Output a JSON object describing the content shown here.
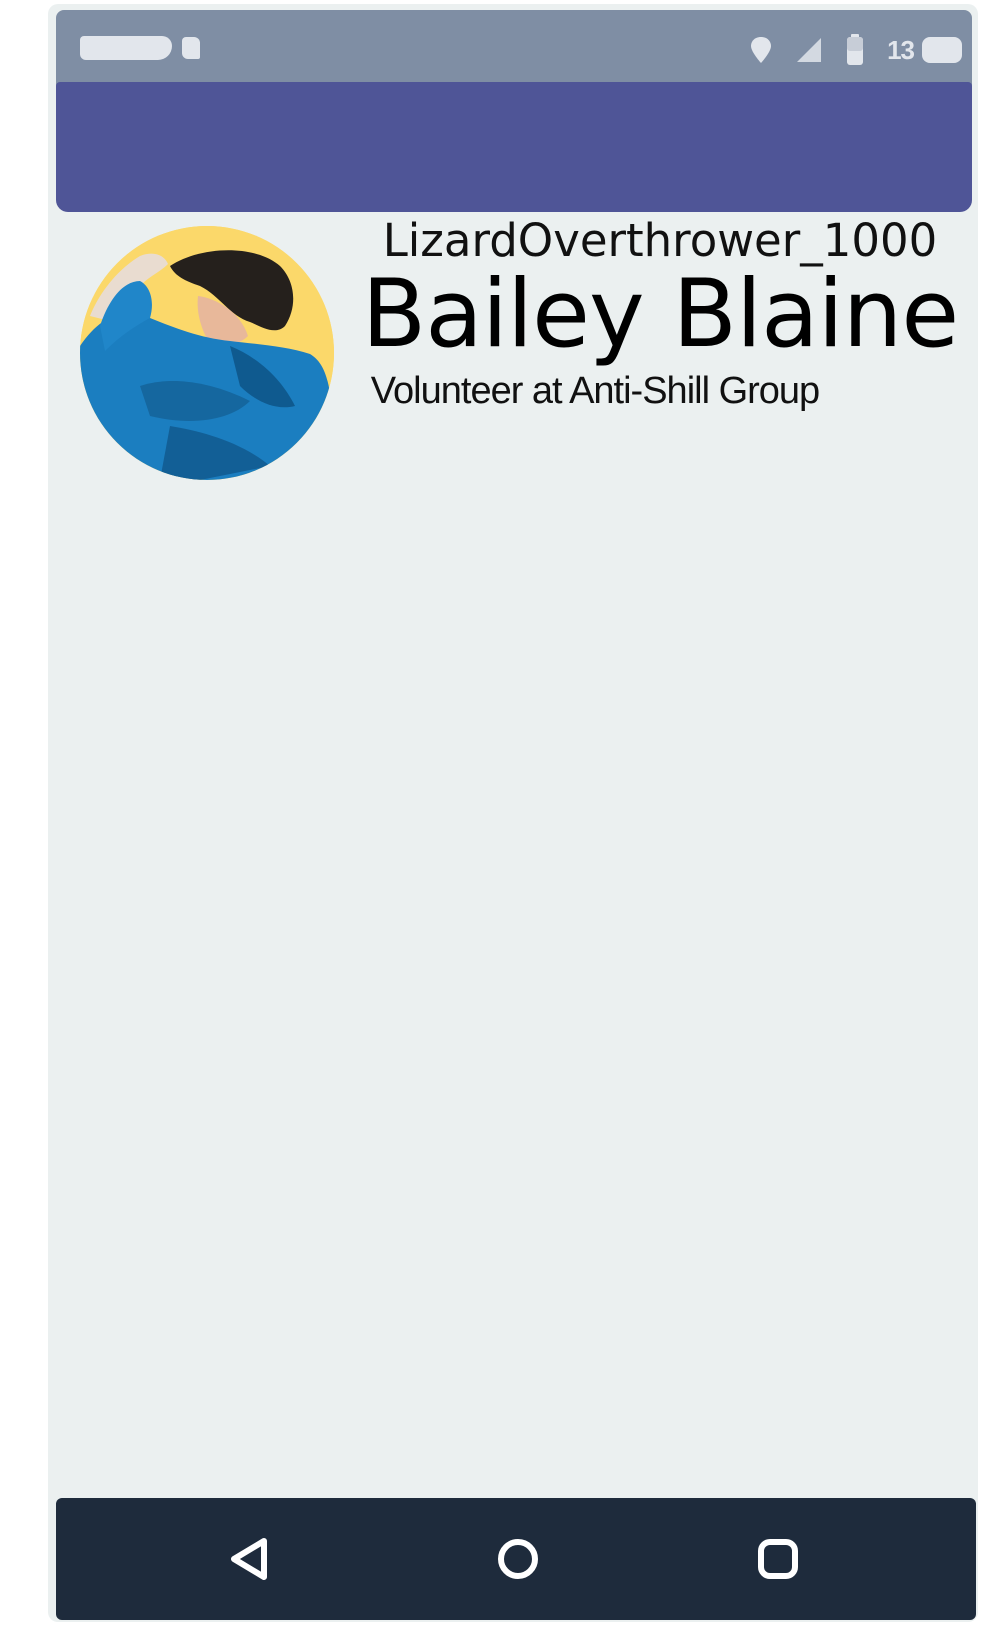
{
  "status_bar": {
    "left_icons": [
      "notification-blob-icon",
      "notification-small-icon"
    ],
    "right_icons": [
      "location-icon",
      "signal-icon",
      "battery-icon"
    ],
    "time": "13"
  },
  "profile": {
    "username": "LizardOverthrower_1000",
    "full_name": "Bailey Blaine",
    "tagline": "Volunteer at Anti-Shill Group",
    "avatar": "avatar-illustration"
  },
  "nav_bar": {
    "buttons": [
      "back-icon",
      "home-icon",
      "recents-icon"
    ]
  },
  "colors": {
    "status_bar": "#7f8ea4",
    "app_bar": "#4f5597",
    "background": "#ebf0f0",
    "nav_bar": "#1e2b3c",
    "avatar_bg": "#fbd86a"
  }
}
